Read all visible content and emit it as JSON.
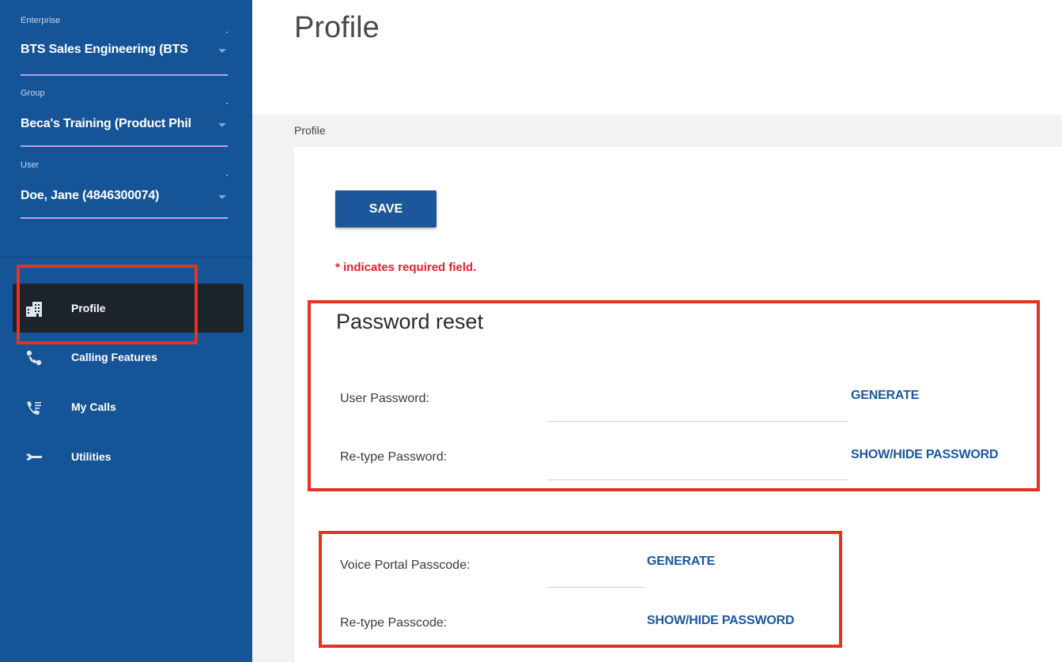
{
  "sidebar": {
    "enterprise": {
      "label": "Enterprise",
      "value": "BTS Sales Engineering (BTS"
    },
    "group": {
      "label": "Group",
      "value": "Beca's Training (Product Phil"
    },
    "user": {
      "label": "User",
      "value": "Doe, Jane (4846300074)"
    },
    "nav": [
      {
        "label": "Profile",
        "icon": "building-icon",
        "active": true
      },
      {
        "label": "Calling Features",
        "icon": "phone-features-icon",
        "active": false
      },
      {
        "label": "My Calls",
        "icon": "call-list-icon",
        "active": false
      },
      {
        "label": "Utilities",
        "icon": "wrench-icon",
        "active": false
      }
    ]
  },
  "main": {
    "title": "Profile",
    "breadcrumb": "Profile",
    "save_label": "SAVE",
    "required_note": "* indicates required field.",
    "password_reset": {
      "title": "Password reset",
      "user_password_label": "User Password:",
      "retype_password_label": "Re-type Password:",
      "generate_label": "GENERATE",
      "show_hide_label": "SHOW/HIDE PASSWORD",
      "user_password_value": "",
      "retype_password_value": ""
    },
    "voice_portal": {
      "passcode_label": "Voice Portal Passcode:",
      "retype_label": "Re-type Passcode:",
      "generate_label": "GENERATE",
      "show_hide_label": "SHOW/HIDE PASSWORD",
      "passcode_value": ""
    }
  },
  "colors": {
    "sidebar_bg": "#165498",
    "active_nav_bg": "#1c232b",
    "accent_blue": "#1b579a",
    "highlight_red": "#e53323",
    "required_red": "#e4202a"
  }
}
